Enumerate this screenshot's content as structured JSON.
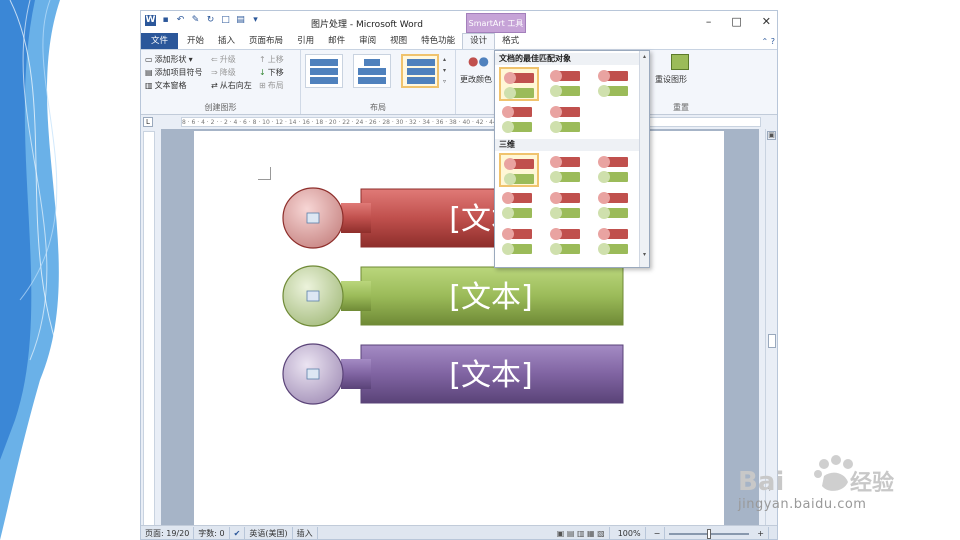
{
  "window": {
    "title": "图片处理 - Microsoft Word",
    "contextual_tab": "SmartArt 工具"
  },
  "tabs": [
    "文件",
    "开始",
    "插入",
    "页面布局",
    "引用",
    "邮件",
    "审阅",
    "视图",
    "特色功能",
    "设计",
    "格式"
  ],
  "ribbon": {
    "create_group": {
      "label": "创建图形",
      "add_shape": "添加形状",
      "add_bullet": "添加项目符号",
      "text_pane": "文本窗格",
      "promote": "升级",
      "demote": "降级",
      "right_to_left": "从右向左",
      "move_up": "上移",
      "move_down": "下移",
      "layout": "布局"
    },
    "layout_group": {
      "label": "布局"
    },
    "change_colors": "更改颜色",
    "reset": {
      "button": "重设图形",
      "label": "重置"
    }
  },
  "styles_popup": {
    "section1": "文档的最佳匹配对象",
    "section2": "三维"
  },
  "shapes": [
    {
      "text": "[文本]",
      "color": "#c0504d",
      "dark": "#8e2e2b",
      "light": "#e9a3a1"
    },
    {
      "text": "[文本]",
      "color": "#9bbb59",
      "dark": "#6f8a36",
      "light": "#cfe0ad"
    },
    {
      "text": "[文本]",
      "color": "#8064a2",
      "dark": "#5a4378",
      "light": "#c5b6d8"
    }
  ],
  "ruler": "8 · 6 · 4 · 2 · · 2 · 4 · 6 · 8 · 10 · 12 · 14 · 16 · 18 · 20 · 22 · 24 · 26 · 28 · 30 · 32 · 34 · 36 · 38 · 40 · 42 · 44 · 46 · 48",
  "status": {
    "page": "页面: 19/20",
    "words": "字数: 0",
    "language": "英语(美国)",
    "mode": "插入",
    "zoom": "100%"
  },
  "watermark": {
    "brand": "Bai",
    "brand2": "经验",
    "url": "jingyan.baidu.com"
  }
}
